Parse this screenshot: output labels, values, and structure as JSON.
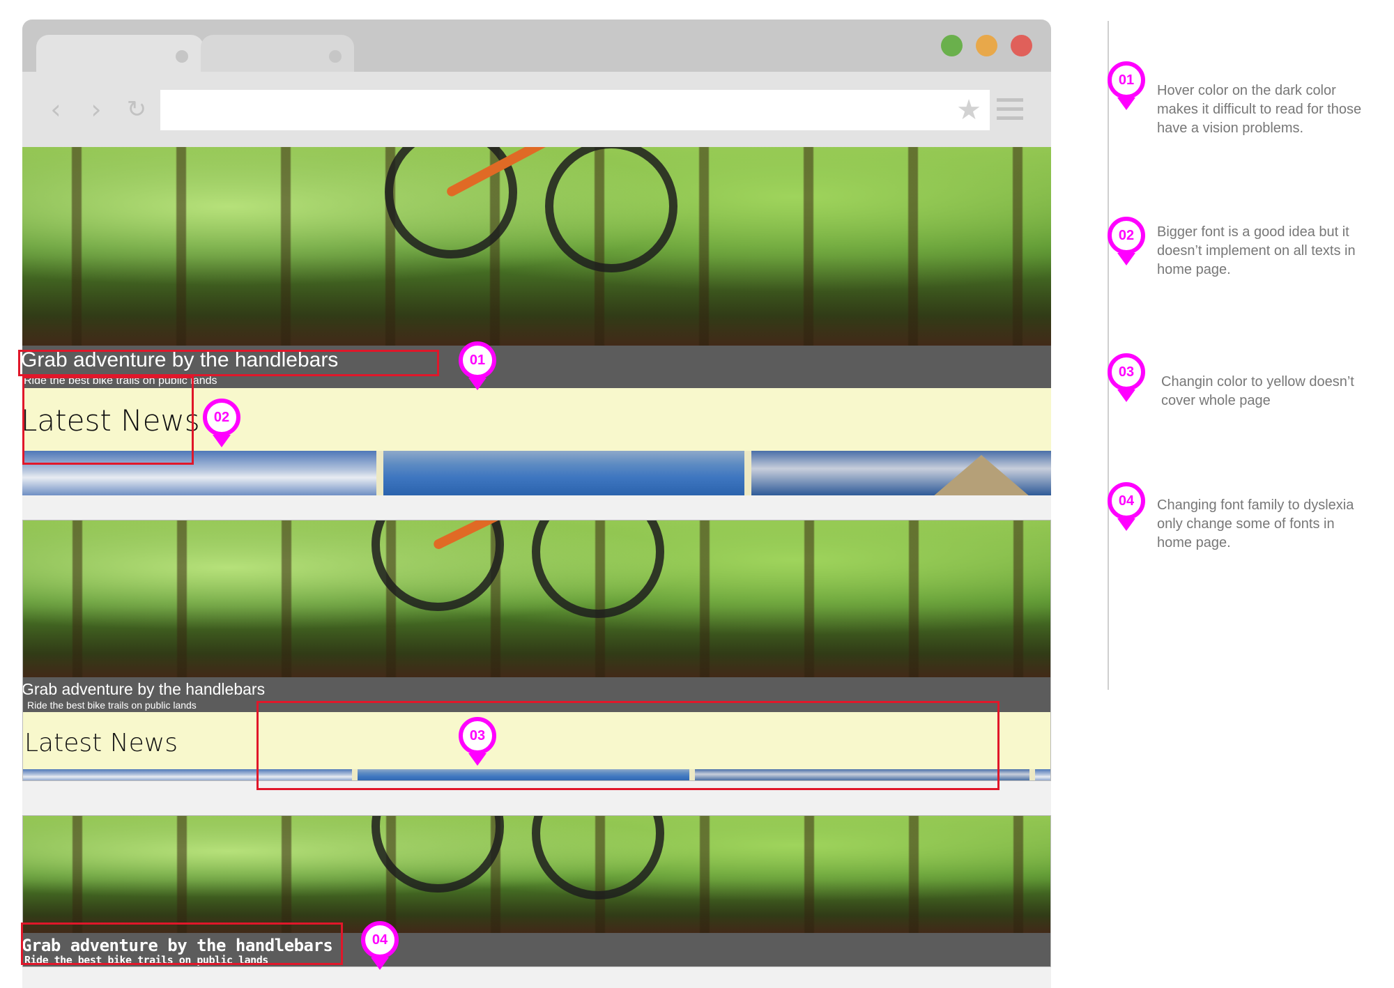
{
  "browser": {
    "window_controls": [
      {
        "name": "window-maximize-button",
        "color": "#6ab04c"
      },
      {
        "name": "window-minimize-button",
        "color": "#e8a84a"
      },
      {
        "name": "window-close-button",
        "color": "#e0605a"
      }
    ],
    "nav_icons": [
      "back-arrow-icon",
      "forward-arrow-icon",
      "reload-icon"
    ],
    "bookmark_icon": "star-icon",
    "menu_icon": "hamburger-menu-icon",
    "address_value": ""
  },
  "screens": [
    {
      "id": "default",
      "hero_title": "Grab adventure by the handlebars",
      "hero_subtitle": "Ride the best bike trails on public lands",
      "news_title": "Latest News"
    },
    {
      "id": "yellow",
      "hero_title": "Grab adventure by the handlebars",
      "hero_subtitle": "Ride the best bike trails on public lands",
      "news_title": "Latest News"
    },
    {
      "id": "dyslexia",
      "hero_title": "Grab adventure by the handlebars",
      "hero_subtitle": "Ride the best bike trails on public lands"
    }
  ],
  "annotations": [
    {
      "number": "01",
      "text": "Hover color on the dark color makes it difficult to read for those have a vision problems."
    },
    {
      "number": "02",
      "text": "Bigger font is a good idea but it doesn’t implement on all texts in home page."
    },
    {
      "number": "03",
      "text": "Changin color to yellow doesn’t cover whole page"
    },
    {
      "number": "04",
      "text": "Changing font family to dyslexia only change some of fonts in home page."
    }
  ],
  "colors": {
    "pin": "#ff00ff",
    "highlight_box": "#e0172a",
    "news_background": "#f8f8cc",
    "caption_overlay": "rgba(0,0,0,0.62)"
  }
}
